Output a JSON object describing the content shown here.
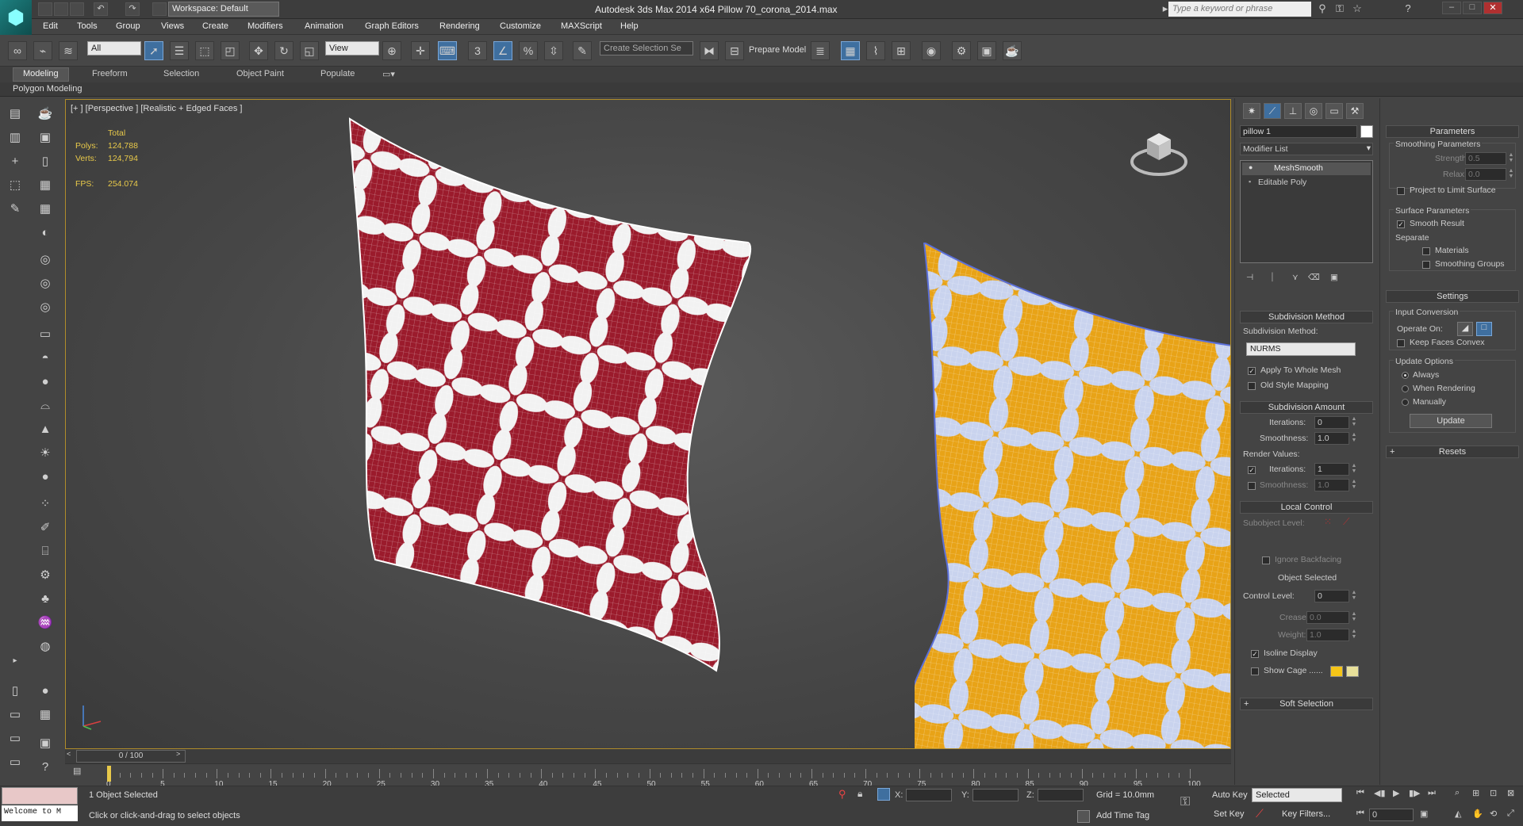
{
  "titlebar": {
    "workspace": "Workspace: Default",
    "app_title": "Autodesk 3ds Max  2014 x64     Pillow 70_corona_2014.max",
    "search_placeholder": "Type a keyword or phrase"
  },
  "menus": [
    "Edit",
    "Tools",
    "Group",
    "Views",
    "Create",
    "Modifiers",
    "Animation",
    "Graph Editors",
    "Rendering",
    "Customize",
    "MAXScript",
    "Help"
  ],
  "toolbar": {
    "selection_filter": "All",
    "ref_coord": "View",
    "named_selection": "Create Selection Se",
    "prepare_model": "Prepare Model"
  },
  "ribbon": {
    "tabs": [
      "Modeling",
      "Freeform",
      "Selection",
      "Object Paint",
      "Populate"
    ],
    "active_tab": "Modeling",
    "panel_label": "Polygon Modeling"
  },
  "viewport": {
    "label": "[+ ] [Perspective ] [Realistic + Edged Faces ]",
    "stats": {
      "total_label": "Total",
      "polys_label": "Polys:",
      "polys_value": "124,788",
      "verts_label": "Verts:",
      "verts_value": "124,794",
      "fps_label": "FPS:",
      "fps_value": "254.074"
    }
  },
  "timeline": {
    "frame_display": "0 / 100",
    "ticks": [
      "0",
      "5",
      "10",
      "15",
      "20",
      "25",
      "30",
      "35",
      "40",
      "45",
      "50",
      "55",
      "60",
      "65",
      "70",
      "75",
      "80",
      "85",
      "90",
      "95",
      "100"
    ]
  },
  "status": {
    "objects_selected": "1 Object Selected",
    "prompt": "Click or click-and-drag to select objects",
    "welcome": "Welcome to M",
    "x_label": "X:",
    "y_label": "Y:",
    "z_label": "Z:",
    "grid": "Grid = 10.0mm",
    "add_time_tag": "Add Time Tag",
    "auto_key": "Auto Key",
    "set_key": "Set Key",
    "key_mode": "Selected",
    "key_filters": "Key Filters...",
    "frame": "0"
  },
  "command_panel": {
    "object_name": "pillow 1",
    "modifier_list": "Modifier List",
    "stack": [
      "MeshSmooth",
      "Editable Poly"
    ],
    "subdivision_method": {
      "header": "Subdivision Method",
      "label": "Subdivision Method:",
      "value": "NURMS",
      "apply_whole_mesh": "Apply To Whole Mesh",
      "old_style": "Old Style Mapping"
    },
    "subdivision_amount": {
      "header": "Subdivision Amount",
      "iterations_label": "Iterations:",
      "iterations": "0",
      "smoothness_label": "Smoothness:",
      "smoothness": "1.0",
      "render_values": "Render Values:",
      "render_iterations": "1",
      "render_smoothness": "1.0"
    },
    "local_control": {
      "header": "Local Control",
      "subobject_level": "Subobject Level:",
      "ignore_backfacing": "Ignore Backfacing",
      "object_selected": "Object Selected",
      "control_level_label": "Control Level:",
      "control_level": "0",
      "crease_label": "Crease:",
      "crease": "0.0",
      "weight_label": "Weight:",
      "weight": "1.0",
      "isoline_display": "Isoline Display",
      "show_cage": "Show Cage ......",
      "cage_color1": "#f5c518",
      "cage_color2": "#e8e09a"
    },
    "soft_selection": "Soft Selection",
    "parameters": {
      "header": "Parameters",
      "smoothing_params": "Smoothing Parameters",
      "strength_label": "Strength:",
      "strength": "0.5",
      "relax_label": "Relax:",
      "relax": "0.0",
      "project_limit": "Project to Limit Surface",
      "surface_params": "Surface Parameters",
      "smooth_result": "Smooth Result",
      "separate": "Separate",
      "materials": "Materials",
      "smoothing_groups": "Smoothing Groups"
    },
    "settings": {
      "header": "Settings",
      "input_conversion": "Input Conversion",
      "operate_on": "Operate On:",
      "keep_faces_convex": "Keep Faces Convex",
      "update_options": "Update Options",
      "always": "Always",
      "when_rendering": "When Rendering",
      "manually": "Manually",
      "update": "Update"
    },
    "resets": "Resets"
  },
  "colors": {
    "pillow_red": "#9b1b2c",
    "pillow_yellow": "#e8a317",
    "viewport_border": "#b08c2a"
  }
}
